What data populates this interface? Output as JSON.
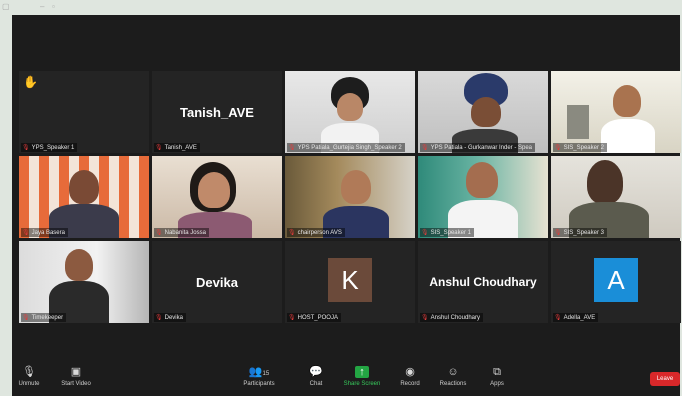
{
  "tiles": [
    {
      "label": "YPS_Speaker 1",
      "hand": "✋"
    },
    {
      "label": "Tanish_AVE",
      "name": "Tanish_AVE"
    },
    {
      "label": "YPS Patiala_Gurtejia Singh_Speaker 2"
    },
    {
      "label": "YPS Patiala - Gurkanwar Inder - Spea"
    },
    {
      "label": "SIS_Speaker 2"
    },
    {
      "label": "Jaya Basera"
    },
    {
      "label": "Nabanita Jossa"
    },
    {
      "label": "chairperson AVS"
    },
    {
      "label": "SIS_Speaker 1"
    },
    {
      "label": "SIS_Speaker 3"
    },
    {
      "label": "Timekeeper"
    },
    {
      "label": "Devika",
      "name": "Devika"
    },
    {
      "label": "HOST_POOJA",
      "initial": "K",
      "avatar_color": "#6b4a3a"
    },
    {
      "label": "Anshul Choudhary",
      "name": "Anshul Choudhary"
    },
    {
      "label": "Adella_AVE",
      "initial": "A",
      "avatar_color": "#1a8ed8"
    }
  ],
  "toolbar": {
    "unmute": "Unmute",
    "start_video": "Start Video",
    "participants": "Participants",
    "participants_count": "15",
    "chat": "Chat",
    "share_screen": "Share Screen",
    "record": "Record",
    "reactions": "Reactions",
    "apps": "Apps",
    "leave": "Leave"
  }
}
